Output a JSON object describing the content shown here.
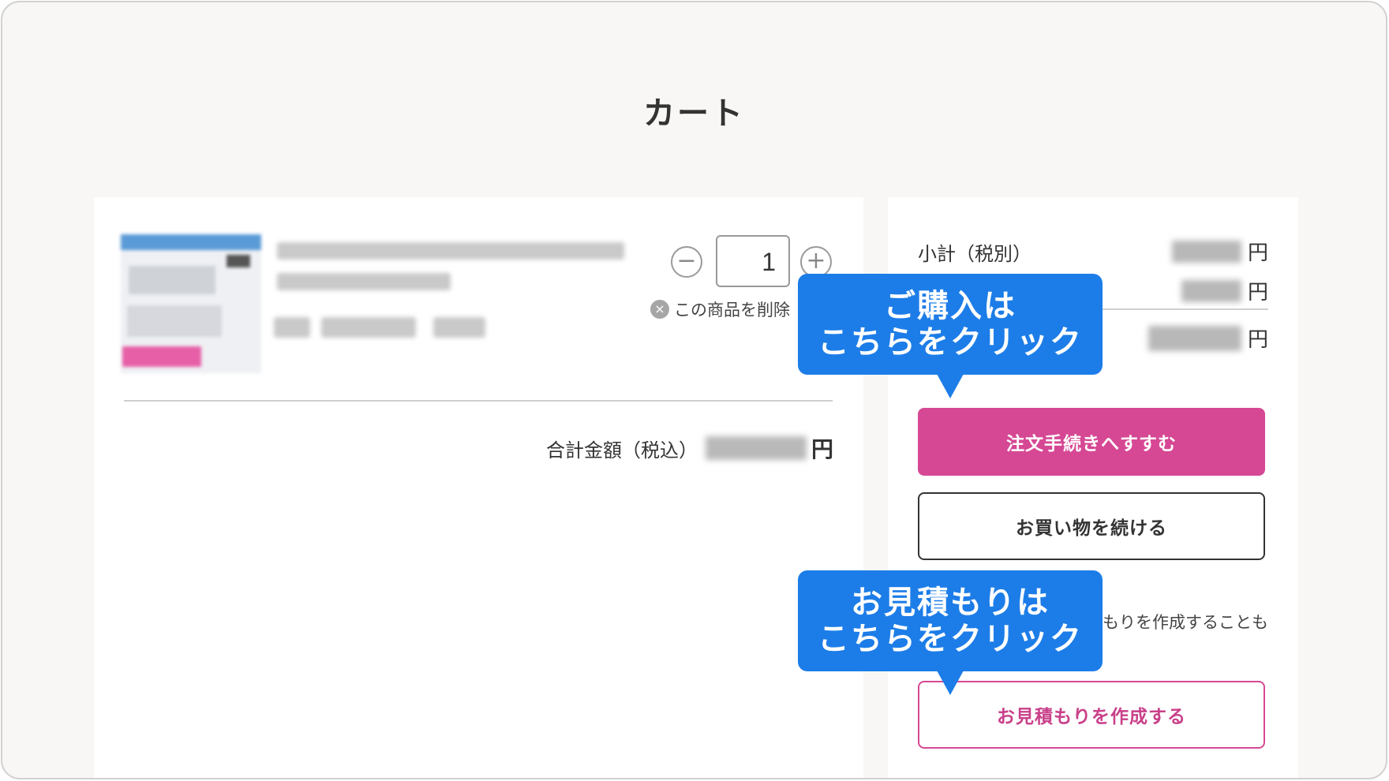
{
  "page": {
    "title": "カート"
  },
  "cart_item": {
    "image_icon": "product-thumbnail-blurred",
    "quantity": "1",
    "minus_symbol": "−",
    "plus_symbol": "+",
    "remove_icon": "close-circle-icon",
    "remove_symbol": "×",
    "remove_label": "この商品を削除"
  },
  "left_total": {
    "label": "合計金額（税込）",
    "currency": "円"
  },
  "summary": {
    "subtotal_label": "小計（税別）",
    "currency": "円",
    "checkout_label": "注文手続きへすすむ",
    "continue_label": "お買い物を続ける",
    "note_fragment": "もりを作成することも",
    "quote_label": "お見積もりを作成する"
  },
  "callouts": {
    "purchase_line1": "ご購入は",
    "purchase_line2": "こちらをクリック",
    "quote_line1": "お見積もりは",
    "quote_line2": "こちらをクリック"
  },
  "colors": {
    "accent_pink": "#d64894",
    "callout_blue": "#1d7de8",
    "background": "#f8f7f5"
  }
}
